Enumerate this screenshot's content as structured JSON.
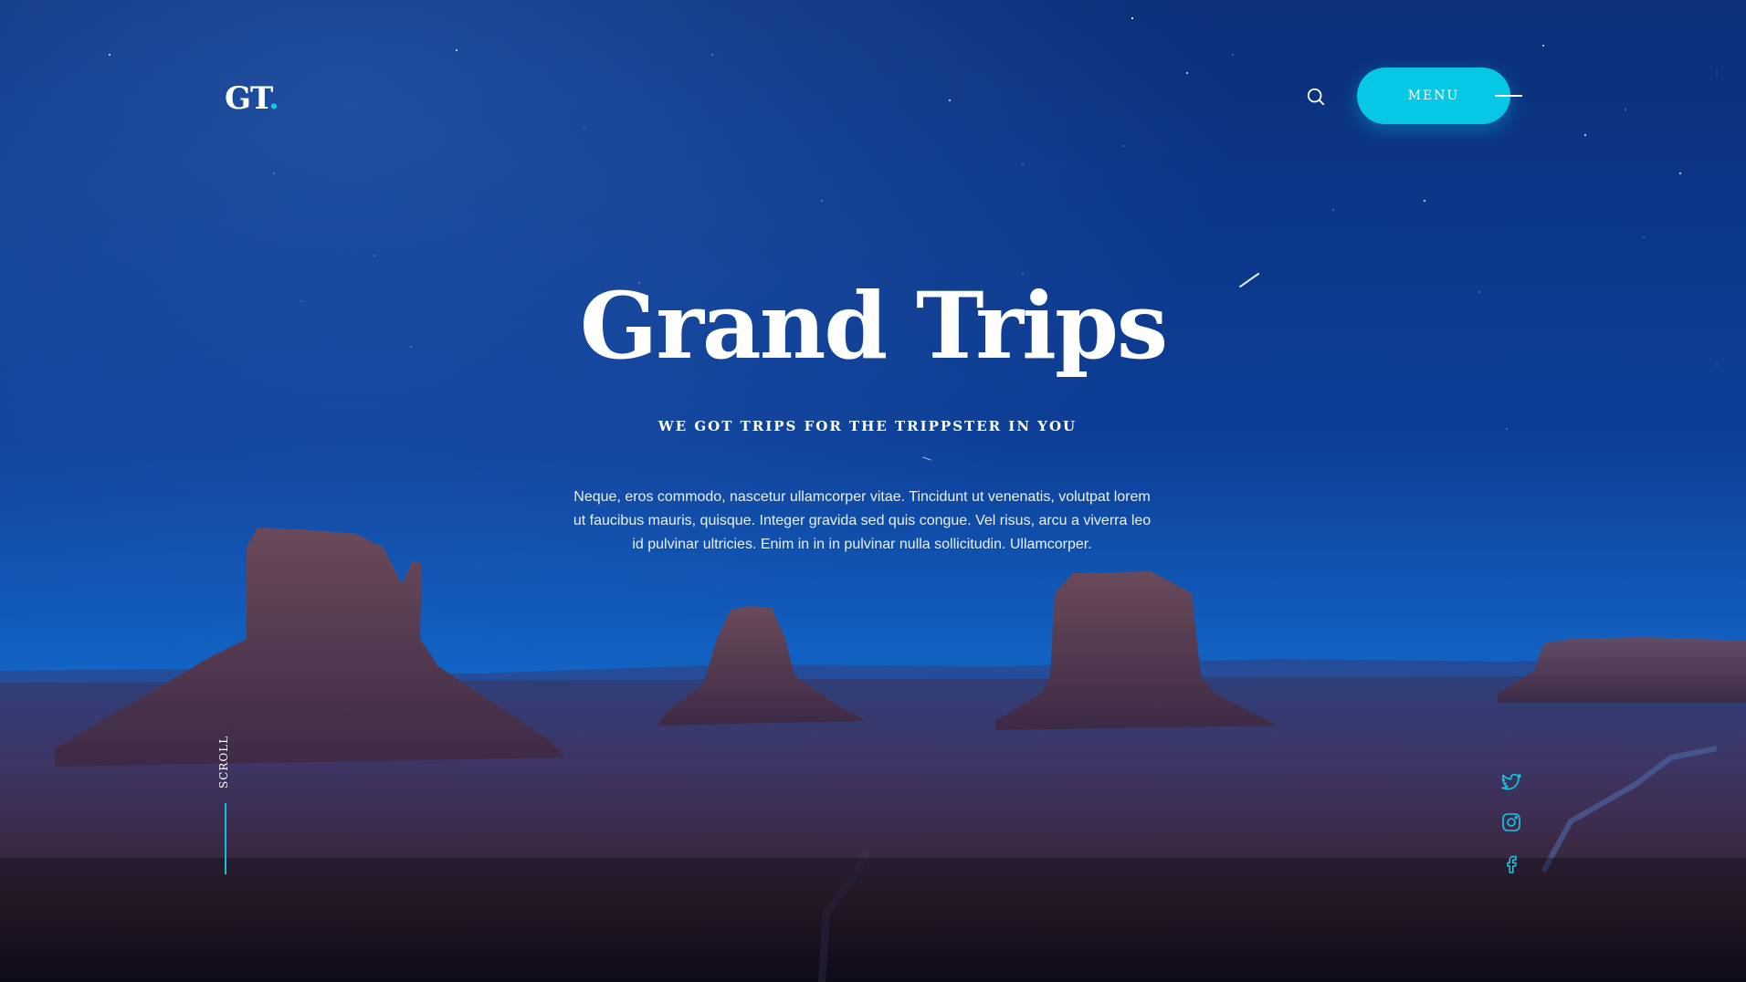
{
  "header": {
    "logo_text": "GT",
    "logo_dot": ".",
    "menu_label": "MENU",
    "search_icon": "search-icon"
  },
  "hero": {
    "title": "Grand Trips",
    "subtitle": "WE GOT TRIPS FOR THE TRIPPSTER IN YOU",
    "body": "Neque, eros commodo, nascetur ullamcorper vitae. Tincidunt ut venenatis, volutpat lorem ut faucibus mauris, quisque. Integer gravida sed quis congue. Vel risus, arcu a viverra leo id pulvinar ultricies. Enim in in in pulvinar nulla sollicitudin. Ullamcorper."
  },
  "scroll": {
    "label": "SCROLL"
  },
  "social": {
    "icons": [
      "twitter-icon",
      "instagram-icon",
      "facebook-icon"
    ]
  },
  "colors": {
    "accent": "#06c8e4",
    "sky_top": "#0b2f78",
    "sky_horizon": "#1366c8",
    "text": "#ffffff"
  }
}
